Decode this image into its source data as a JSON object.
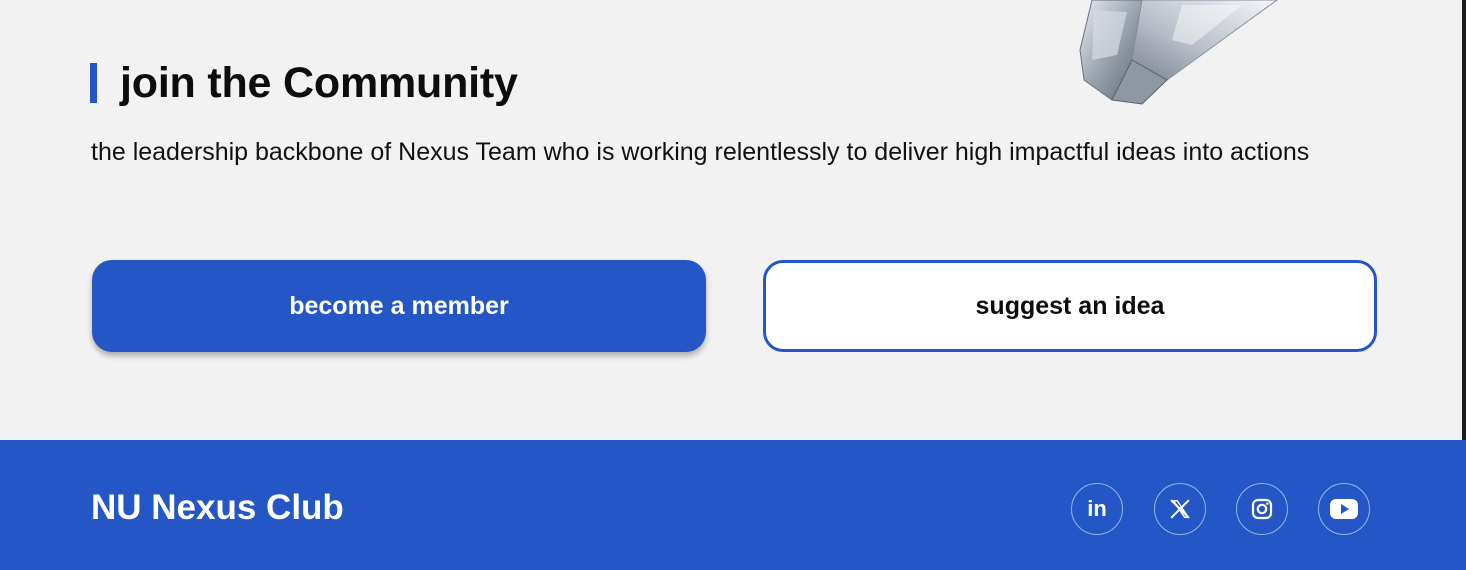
{
  "section": {
    "heading": "join the Community",
    "description": "the leadership backbone of Nexus Team who is working relentlessly to deliver high impactful ideas into actions"
  },
  "actions": {
    "primary_label": "become a member",
    "secondary_label": "suggest an idea"
  },
  "footer": {
    "brand": "NU Nexus Club",
    "socials": [
      {
        "icon": "linkedin-icon",
        "label": "in"
      },
      {
        "icon": "x-icon"
      },
      {
        "icon": "instagram-icon"
      },
      {
        "icon": "youtube-icon"
      }
    ]
  },
  "colors": {
    "accent": "#2457c5",
    "background": "#f2f2f2",
    "text": "#0d0d0d"
  }
}
